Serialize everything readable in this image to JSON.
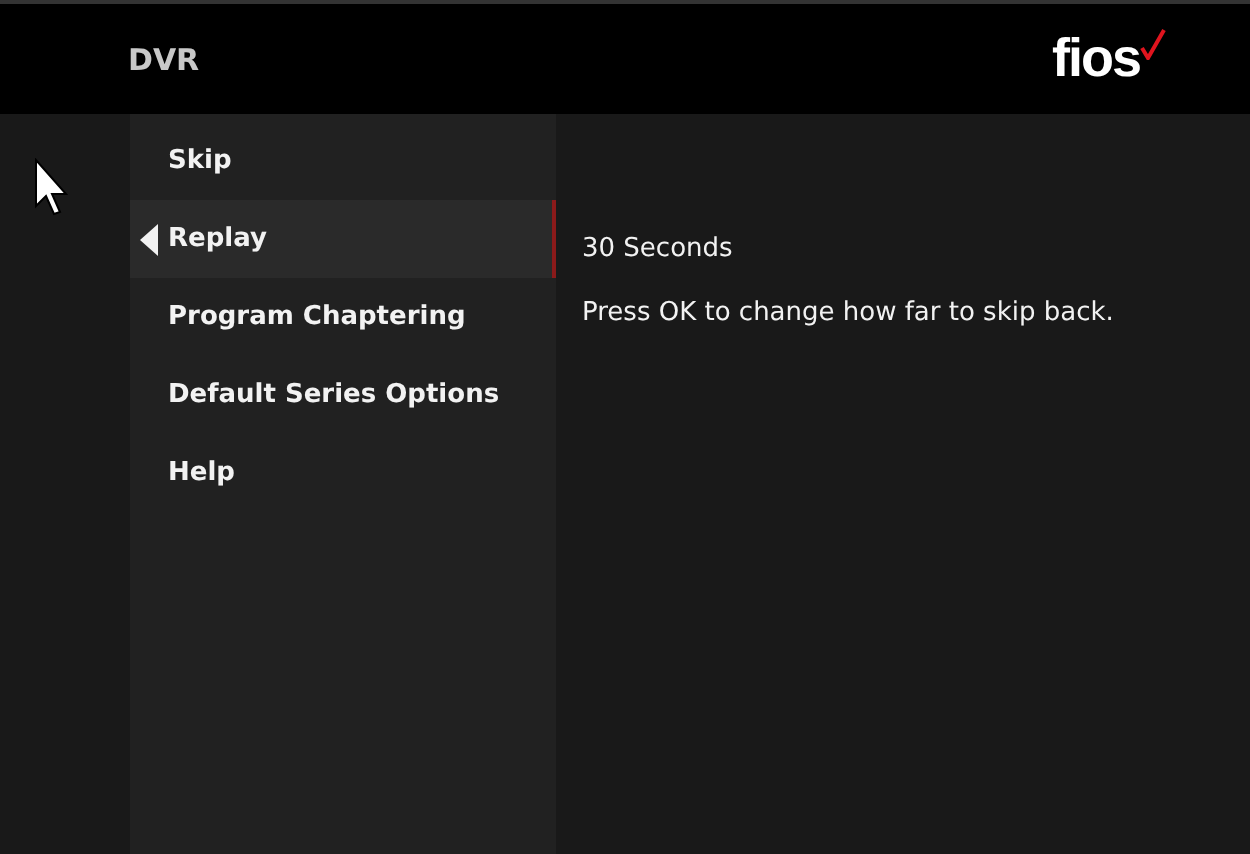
{
  "header": {
    "title": "DVR",
    "logo": "fios"
  },
  "menu": [
    {
      "label": "Skip",
      "selected": false
    },
    {
      "label": "Replay",
      "selected": true
    },
    {
      "label": "Program Chaptering",
      "selected": false
    },
    {
      "label": "Default Series Options",
      "selected": false
    },
    {
      "label": "Help",
      "selected": false
    }
  ],
  "detail": {
    "value": "30 Seconds",
    "hint": "Press OK to change how far to skip back."
  }
}
